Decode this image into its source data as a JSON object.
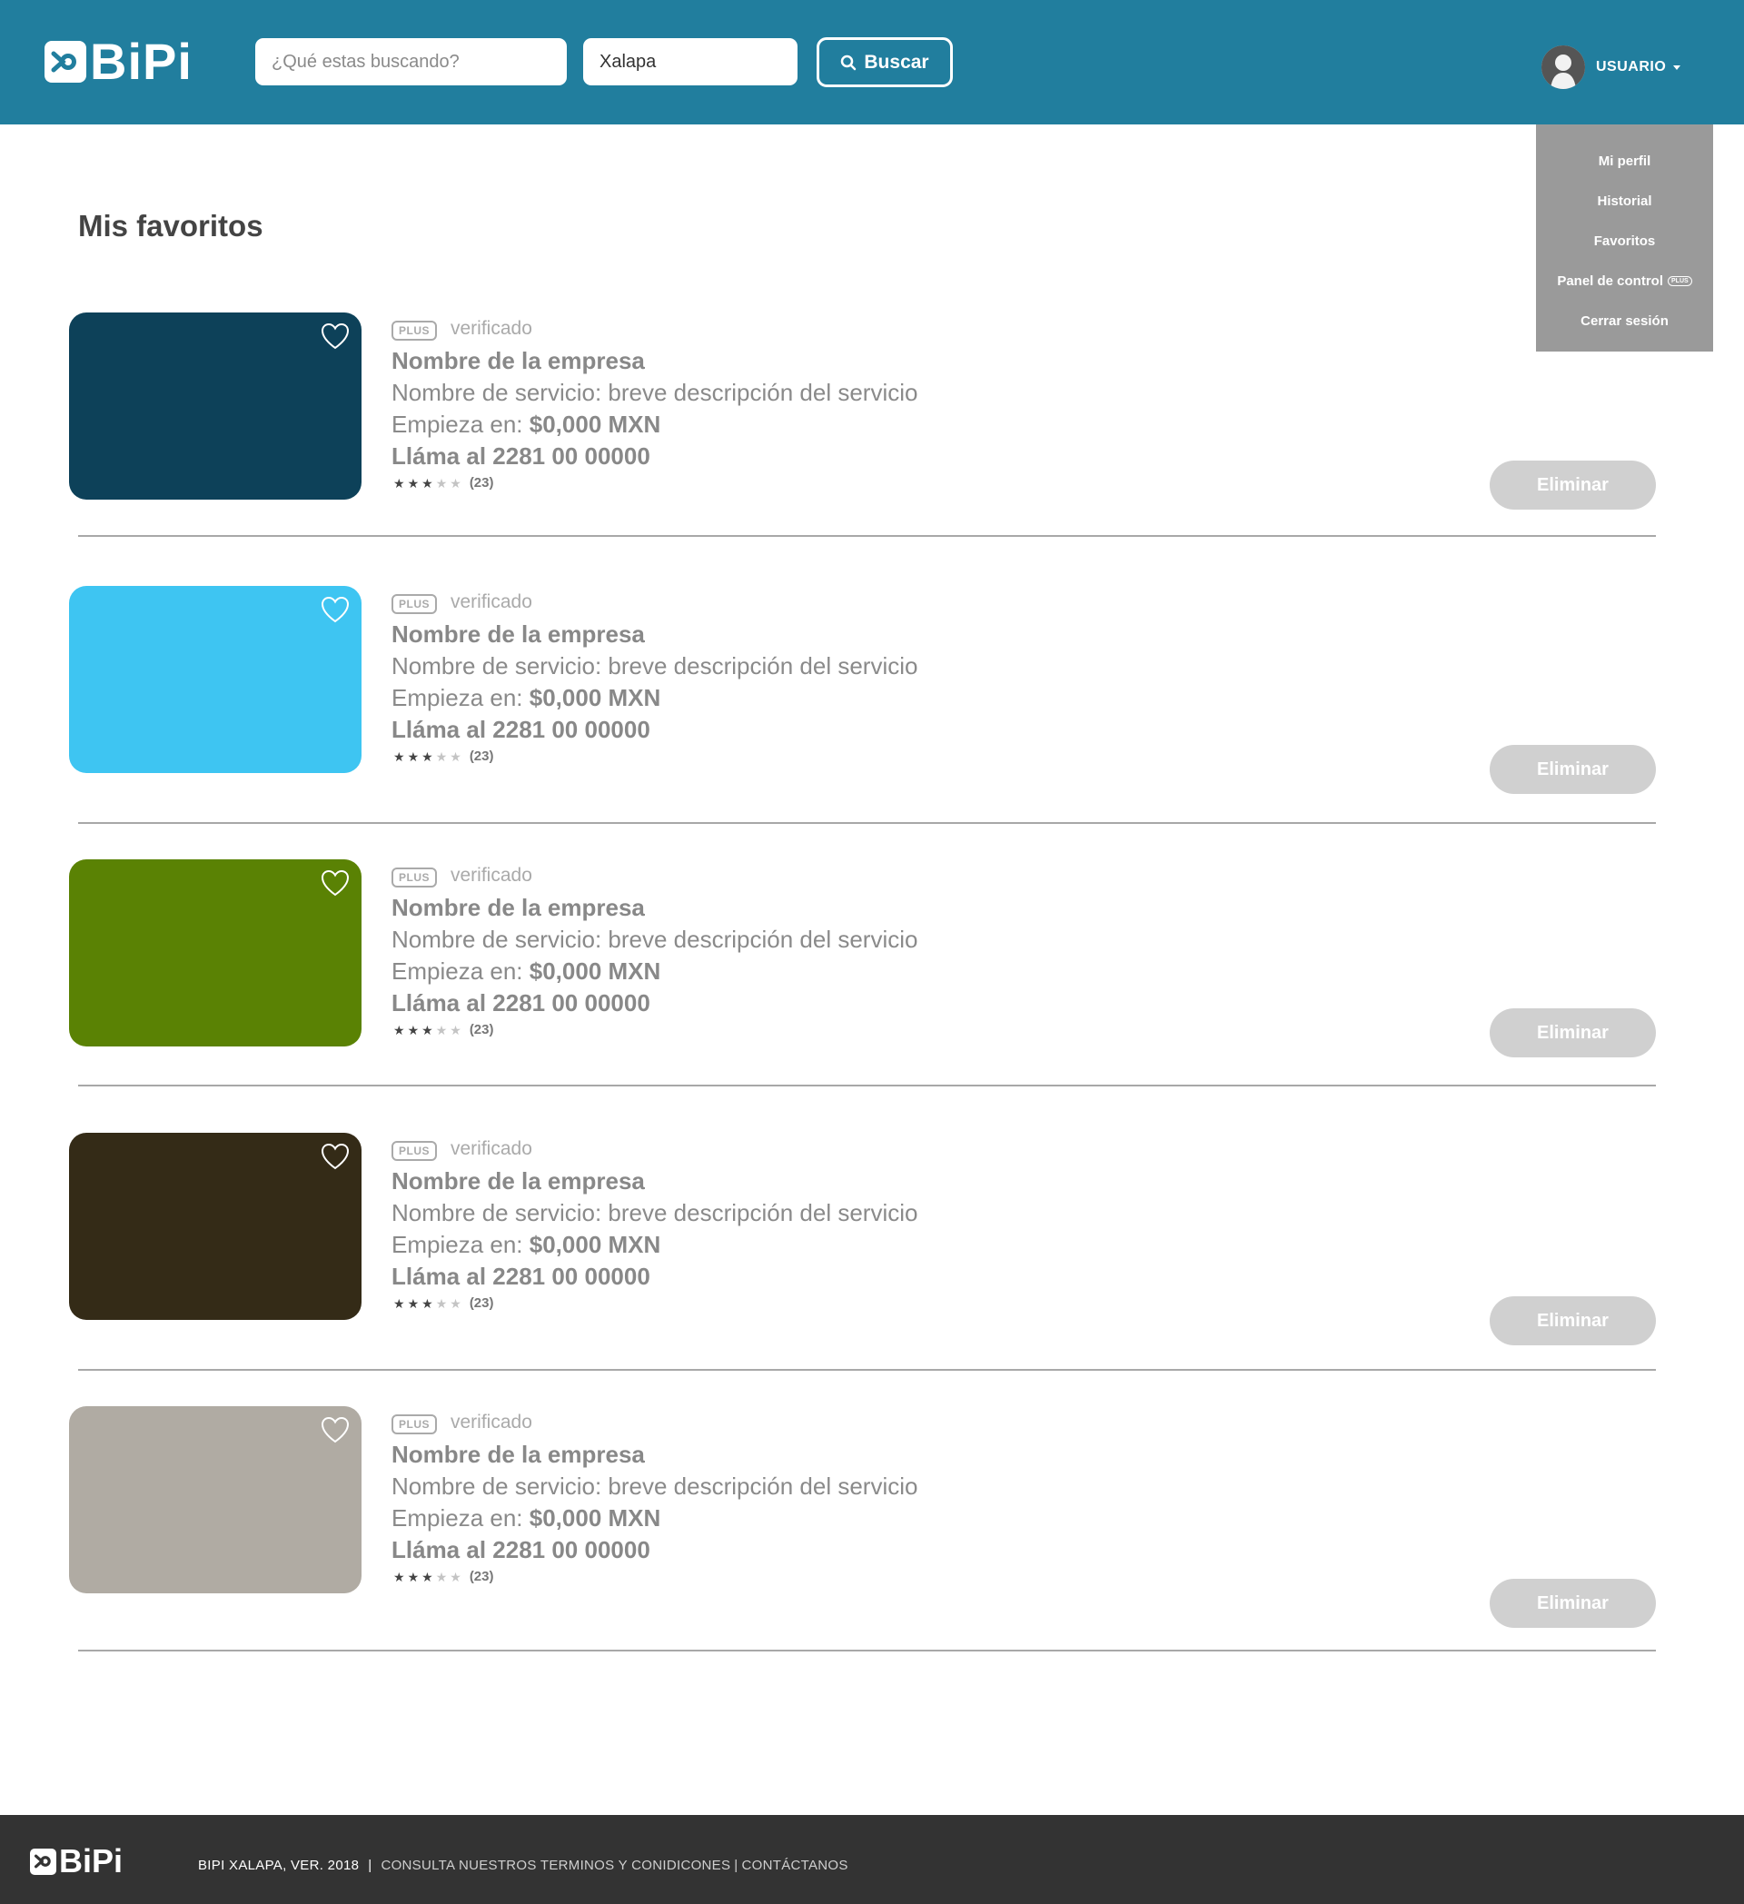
{
  "header": {
    "logo_text": "BiPi",
    "search_placeholder": "¿Qué estas buscando?",
    "location_value": "Xalapa",
    "search_button_label": "Buscar",
    "user_label": "USUARIO"
  },
  "dropdown": {
    "items": [
      {
        "label": "Mi perfil"
      },
      {
        "label": "Historial"
      },
      {
        "label": "Favoritos"
      },
      {
        "label": "Panel de control",
        "badge": "PLUS"
      },
      {
        "label": "Cerrar sesión"
      }
    ]
  },
  "page_title": "Mis favoritos",
  "favorites": [
    {
      "color": "#0d4159",
      "badge": "PLUS",
      "verified": "verificado",
      "company": "Nombre de la empresa",
      "service": "Nombre de servicio: breve descripción del servicio",
      "price_prefix": "Empieza en:",
      "price": "$0,000 MXN",
      "phone": "Lláma al 2281 00 00000",
      "rating": 3,
      "reviews": "(23)",
      "delete_label": "Eliminar"
    },
    {
      "color": "#3ec5f2",
      "badge": "PLUS",
      "verified": "verificado",
      "company": "Nombre de la empresa",
      "service": "Nombre de servicio: breve descripción del servicio",
      "price_prefix": "Empieza en:",
      "price": "$0,000 MXN",
      "phone": "Lláma al 2281 00 00000",
      "rating": 3,
      "reviews": "(23)",
      "delete_label": "Eliminar"
    },
    {
      "color": "#5a8204",
      "badge": "PLUS",
      "verified": "verificado",
      "company": "Nombre de la empresa",
      "service": "Nombre de servicio: breve descripción del servicio",
      "price_prefix": "Empieza en:",
      "price": "$0,000 MXN",
      "phone": "Lláma al 2281 00 00000",
      "rating": 3,
      "reviews": "(23)",
      "delete_label": "Eliminar"
    },
    {
      "color": "#342b17",
      "badge": "PLUS",
      "verified": "verificado",
      "company": "Nombre de la empresa",
      "service": "Nombre de servicio: breve descripción del servicio",
      "price_prefix": "Empieza en:",
      "price": "$0,000 MXN",
      "phone": "Lláma al 2281 00 00000",
      "rating": 3,
      "reviews": "(23)",
      "delete_label": "Eliminar"
    },
    {
      "color": "#b0aba3",
      "badge": "PLUS",
      "verified": "verificado",
      "company": "Nombre de la empresa",
      "service": "Nombre de servicio: breve descripción del servicio",
      "price_prefix": "Empieza en:",
      "price": "$0,000 MXN",
      "phone": "Lláma al 2281 00 00000",
      "rating": 3,
      "reviews": "(23)",
      "delete_label": "Eliminar"
    }
  ],
  "footer": {
    "logo_text": "BiPi",
    "version": "BIPI XALAPA, VER.  2018",
    "separator": "|",
    "terms_link": "CONSULTA NUESTROS TERMINOS Y CONIDICONES",
    "separator2": "|",
    "contact_link": "CONTÁCTANOS"
  },
  "colors": {
    "header_bg": "#217e9e",
    "footer_bg": "#333333",
    "dropdown_bg": "#9a9a9a",
    "delete_button_bg": "#d0d0d0"
  }
}
